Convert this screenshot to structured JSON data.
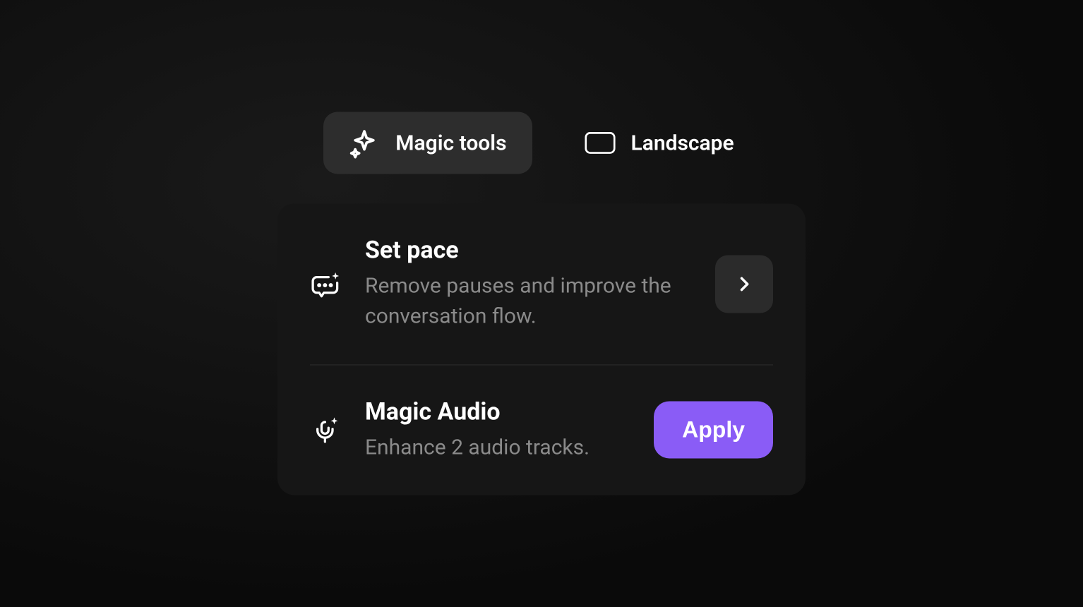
{
  "tabs": {
    "magic_tools": {
      "label": "Magic tools",
      "active": true
    },
    "landscape": {
      "label": "Landscape",
      "active": false
    }
  },
  "panel": {
    "set_pace": {
      "title": "Set pace",
      "description": "Remove pauses and improve the conversation flow."
    },
    "magic_audio": {
      "title": "Magic Audio",
      "description": "Enhance 2 audio tracks.",
      "apply_label": "Apply"
    }
  },
  "colors": {
    "accent": "#8a5cf6",
    "background_panel": "#161616",
    "background_tab_active": "#2d2d2d",
    "text_primary": "#ffffff",
    "text_secondary": "#8a8a8a"
  }
}
